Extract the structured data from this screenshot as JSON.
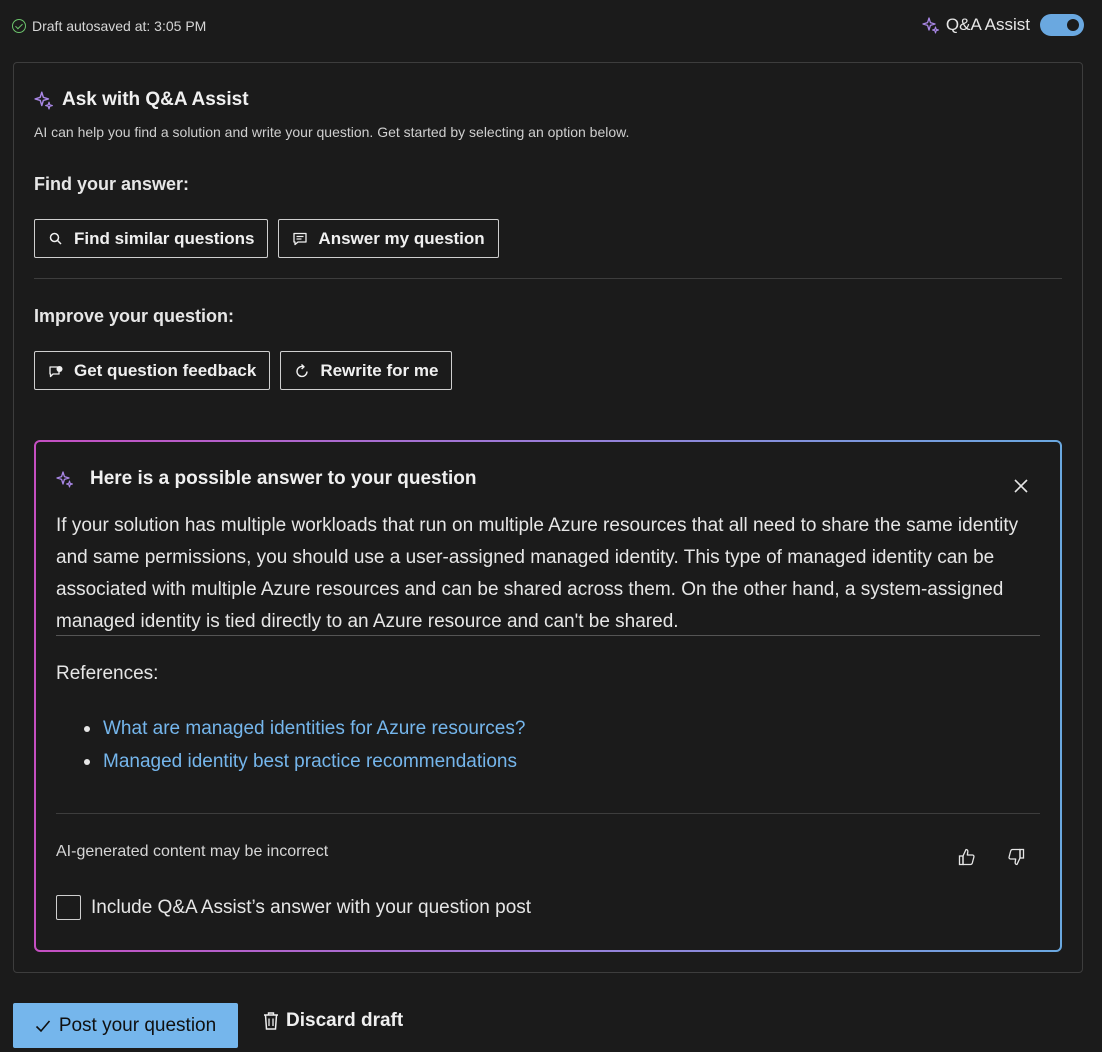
{
  "header": {
    "autosave_text": "Draft autosaved at: 3:05 PM",
    "assist_label": "Q&A Assist",
    "assist_enabled": true
  },
  "panel": {
    "title": "Ask with Q&A Assist",
    "subtitle": "AI can help you find a solution and write your question. Get started by selecting an option below.",
    "find_section": {
      "label": "Find your answer:",
      "buttons": [
        {
          "label": "Find similar questions",
          "icon": "search-icon"
        },
        {
          "label": "Answer my question",
          "icon": "chat-icon"
        }
      ]
    },
    "improve_section": {
      "label": "Improve your question:",
      "buttons": [
        {
          "label": "Get question feedback",
          "icon": "feedback-icon"
        },
        {
          "label": "Rewrite for me",
          "icon": "refresh-icon"
        }
      ]
    }
  },
  "answer": {
    "title": "Here is a possible answer to your question",
    "text": "If your solution has multiple workloads that run on multiple Azure resources that all need to share the same identity and same permissions, you should use a user-assigned managed identity. This type of managed identity can be associated with multiple Azure resources and can be shared across them. On the other hand, a system-assigned managed identity is tied directly to an Azure resource and can't be shared.",
    "references_label": "References:",
    "references": [
      "What are managed identities for Azure resources?",
      "Managed identity best practice recommendations"
    ],
    "disclaimer": "AI-generated content may be incorrect",
    "include_label": "Include Q&A Assist’s answer with your question post",
    "include_checked": false
  },
  "actions": {
    "post_label": "Post your question",
    "discard_label": "Discard draft"
  },
  "colors": {
    "accent": "#75b6ec",
    "gradient_start": "#c54fc2",
    "gradient_end": "#6aa8e0",
    "background": "#1b1b1b"
  }
}
